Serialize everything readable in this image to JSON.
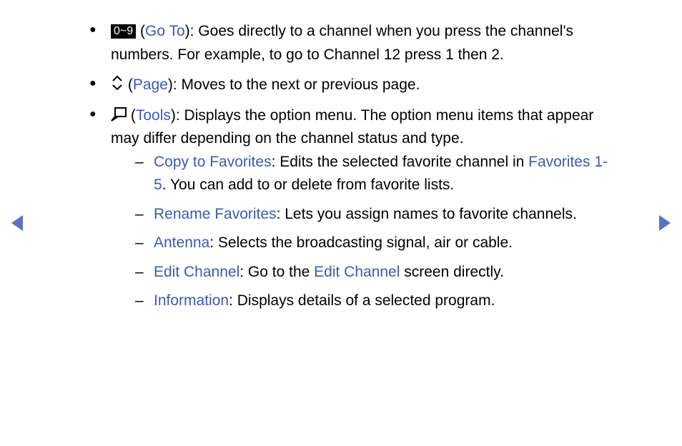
{
  "bullets": {
    "goto": {
      "keycap": "0~9",
      "link": "Go To",
      "text": "): Goes directly to a channel when you press the channel's numbers. For example, to go to Channel 12 press 1 then 2."
    },
    "page": {
      "link": "Page",
      "text": "): Moves to the next or previous page."
    },
    "tools": {
      "link": "Tools",
      "text": "): Displays the option menu. The option menu items that appear may differ depending on the channel status and type."
    }
  },
  "subitems": {
    "copy": {
      "label": "Copy to Favorites",
      "text1": ": Edits the selected favorite channel in ",
      "link": "Favorites 1-5",
      "text2": ". You can add to or delete from favorite lists."
    },
    "rename": {
      "label": "Rename Favorites",
      "text": ": Lets you assign names to favorite channels."
    },
    "antenna": {
      "label": "Antenna",
      "text": ": Selects the broadcasting signal, air or cable."
    },
    "editchannel": {
      "label": "Edit Channel",
      "text1": ": Go to the ",
      "link": "Edit Channel",
      "text2": " screen directly."
    },
    "information": {
      "label": "Information",
      "text": ": Displays details of a selected program."
    }
  },
  "punct": {
    "openparen": "("
  }
}
